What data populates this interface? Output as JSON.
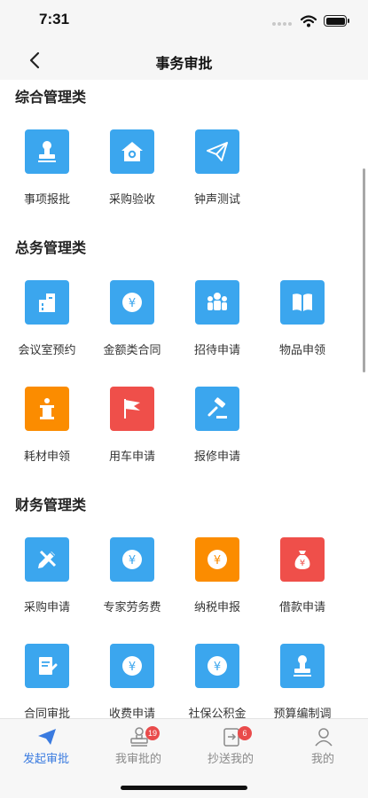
{
  "status": {
    "time": "7:31"
  },
  "header": {
    "title": "事务审批"
  },
  "colors": {
    "blue": "#3ba6ee",
    "orange": "#fb8c00",
    "red": "#ef4f4a",
    "active_tab": "#3a7be0"
  },
  "sections": [
    {
      "title": "综合管理类",
      "items": [
        {
          "label": "事项报批",
          "icon": "seal-stamp-icon",
          "color": "blue"
        },
        {
          "label": "采购验收",
          "icon": "house-gear-icon",
          "color": "blue"
        },
        {
          "label": "钟声测试",
          "icon": "paper-plane-icon",
          "color": "blue"
        }
      ]
    },
    {
      "title": "总务管理类",
      "items": [
        {
          "label": "会议室预约",
          "icon": "building-icon",
          "color": "blue"
        },
        {
          "label": "金额类合同",
          "icon": "yuan-coin-icon",
          "color": "blue"
        },
        {
          "label": "招待申请",
          "icon": "people-group-icon",
          "color": "blue"
        },
        {
          "label": "物品申领",
          "icon": "open-book-icon",
          "color": "blue"
        },
        {
          "label": "耗材申领",
          "icon": "podium-icon",
          "color": "orange"
        },
        {
          "label": "用车申请",
          "icon": "flag-icon",
          "color": "red"
        },
        {
          "label": "报修申请",
          "icon": "gavel-icon",
          "color": "blue"
        }
      ]
    },
    {
      "title": "财务管理类",
      "items": [
        {
          "label": "采购申请",
          "icon": "pencil-ruler-icon",
          "color": "blue"
        },
        {
          "label": "专家劳务费",
          "icon": "yuan-coin-icon",
          "color": "blue"
        },
        {
          "label": "纳税申报",
          "icon": "yuan-coin-icon",
          "color": "orange"
        },
        {
          "label": "借款申请",
          "icon": "money-bag-icon",
          "color": "red"
        },
        {
          "label": "合同审批",
          "icon": "document-edit-icon",
          "color": "blue"
        },
        {
          "label": "收费申请",
          "icon": "yuan-coin-icon",
          "color": "blue"
        },
        {
          "label": "社保公积金",
          "icon": "yuan-coin-icon",
          "color": "blue"
        },
        {
          "label": "预算编制调",
          "icon": "seal-stamp-icon",
          "color": "blue"
        }
      ]
    }
  ],
  "tabs": [
    {
      "label": "发起审批",
      "icon": "paper-plane-icon",
      "active": true
    },
    {
      "label": "我审批的",
      "icon": "stamp-outline-icon",
      "badge": "19"
    },
    {
      "label": "抄送我的",
      "icon": "forward-doc-icon",
      "badge": "6"
    },
    {
      "label": "我的",
      "icon": "user-icon"
    }
  ]
}
